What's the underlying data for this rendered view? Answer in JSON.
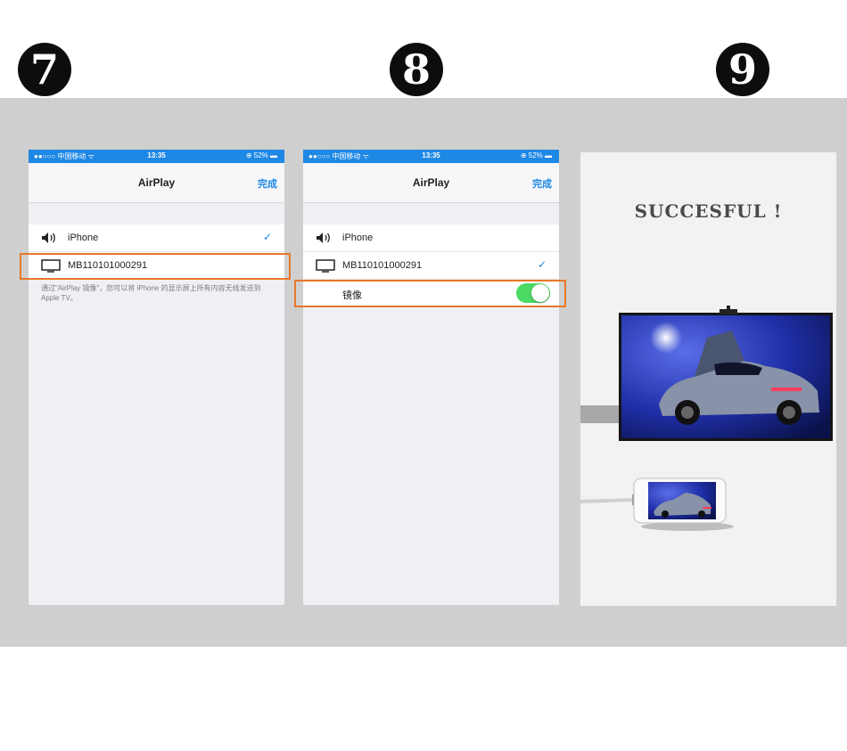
{
  "steps": {
    "seven": "7",
    "eight": "8",
    "nine": "9"
  },
  "status_bar": {
    "carrier": "●●○○○ 中国移动 ᯤ",
    "time": "13:35",
    "battery": "⊕ 52% ▬"
  },
  "screen7": {
    "title": "AirPlay",
    "done": "完成",
    "row_iphone": "iPhone",
    "row_device": "MB110101000291",
    "check": "✓",
    "footnote": "通过\"AirPlay 镜像\"，您可以将 iPhone 的显示屏上所有内容无线发送到 Apple TV。"
  },
  "screen8": {
    "title": "AirPlay",
    "done": "完成",
    "row_iphone": "iPhone",
    "row_device": "MB110101000291",
    "check": "✓",
    "row_mirror": "镜像",
    "mirror_on": true
  },
  "screen9": {
    "message": "SUCCESFUL !"
  },
  "colors": {
    "ios_blue": "#1e88e5",
    "highlight_orange": "#e8782a",
    "toggle_green": "#4cd964"
  },
  "icons": [
    "speaker-icon",
    "tv-icon",
    "checkmark-icon",
    "toggle-switch",
    "tv-stand",
    "car-photo"
  ]
}
